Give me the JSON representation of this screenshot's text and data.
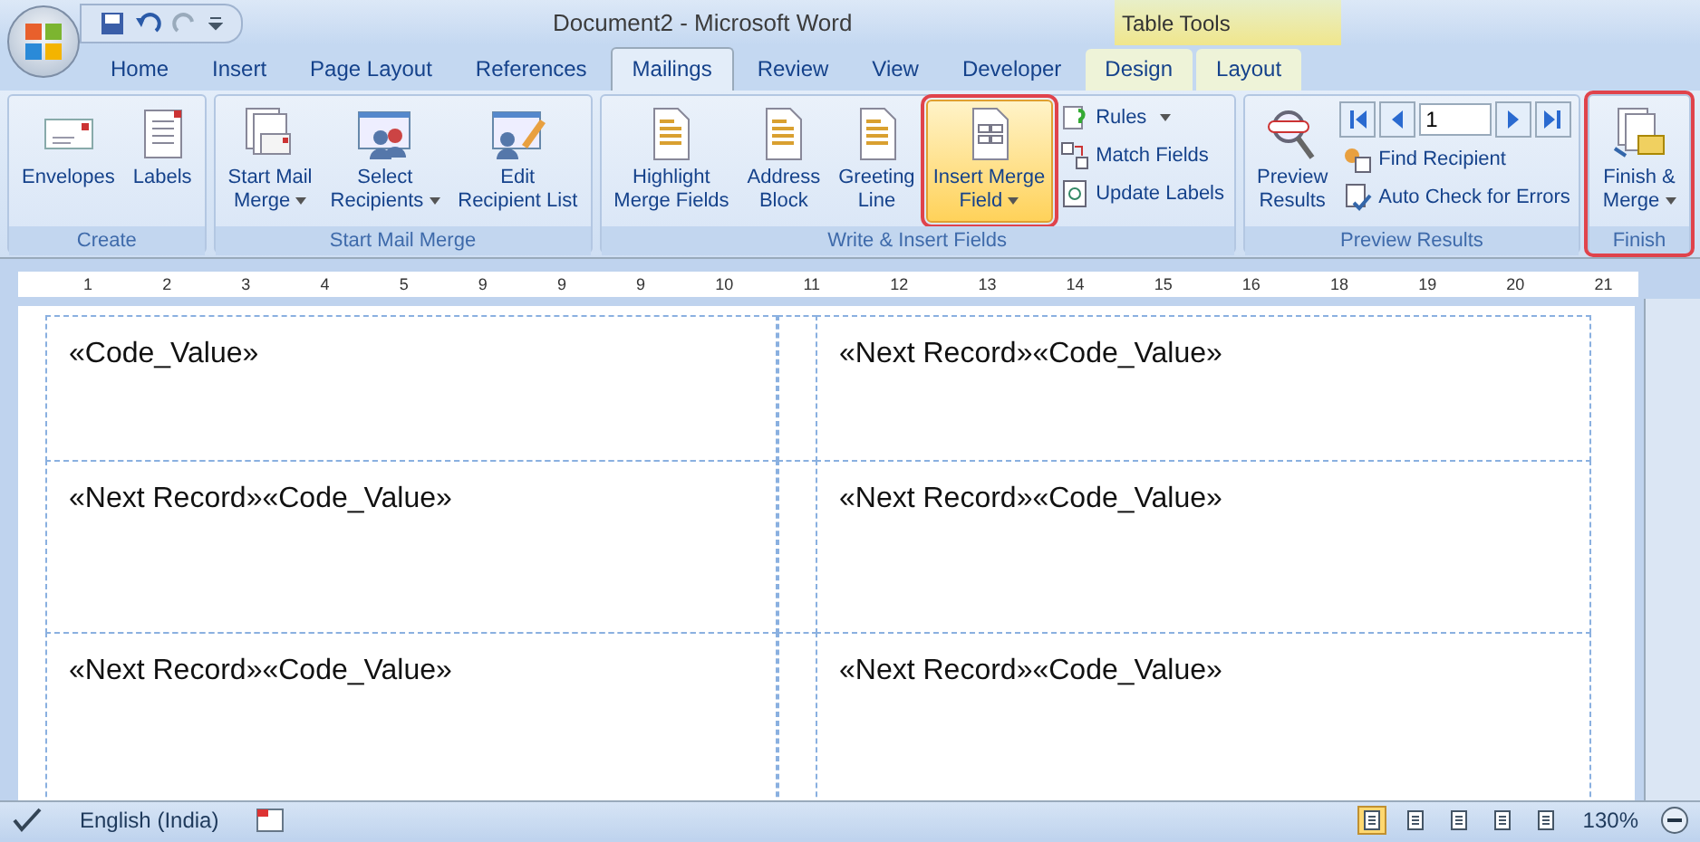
{
  "window": {
    "title": "Document2 - Microsoft Word",
    "context_group": "Table Tools"
  },
  "tabs": [
    {
      "label": "Home",
      "selected": false,
      "kind": "normal"
    },
    {
      "label": "Insert",
      "selected": false,
      "kind": "normal"
    },
    {
      "label": "Page Layout",
      "selected": false,
      "kind": "normal"
    },
    {
      "label": "References",
      "selected": false,
      "kind": "normal"
    },
    {
      "label": "Mailings",
      "selected": true,
      "kind": "normal"
    },
    {
      "label": "Review",
      "selected": false,
      "kind": "normal"
    },
    {
      "label": "View",
      "selected": false,
      "kind": "normal"
    },
    {
      "label": "Developer",
      "selected": false,
      "kind": "normal"
    },
    {
      "label": "Design",
      "selected": false,
      "kind": "contextual"
    },
    {
      "label": "Layout",
      "selected": false,
      "kind": "contextual"
    }
  ],
  "ribbon": {
    "groups": [
      {
        "label": "Create",
        "outlined": false,
        "items": [
          {
            "kind": "large",
            "label": "Envelopes",
            "dropdown": false,
            "highlighted": false
          },
          {
            "kind": "large",
            "label": "Labels",
            "dropdown": false,
            "highlighted": false
          }
        ]
      },
      {
        "label": "Start Mail Merge",
        "outlined": false,
        "items": [
          {
            "kind": "large",
            "label": "Start Mail\nMerge",
            "dropdown": true,
            "highlighted": false
          },
          {
            "kind": "large",
            "label": "Select\nRecipients",
            "dropdown": true,
            "highlighted": false
          },
          {
            "kind": "large",
            "label": "Edit\nRecipient List",
            "dropdown": false,
            "highlighted": false
          }
        ]
      },
      {
        "label": "Write & Insert Fields",
        "outlined": false,
        "items": [
          {
            "kind": "large",
            "label": "Highlight\nMerge Fields",
            "dropdown": false,
            "highlighted": false
          },
          {
            "kind": "large",
            "label": "Address\nBlock",
            "dropdown": false,
            "highlighted": false
          },
          {
            "kind": "large",
            "label": "Greeting\nLine",
            "dropdown": false,
            "highlighted": false
          },
          {
            "kind": "large",
            "label": "Insert Merge\nField",
            "dropdown": true,
            "highlighted": true
          },
          {
            "kind": "small",
            "label": "Rules",
            "dropdown": true
          },
          {
            "kind": "small",
            "label": "Match Fields",
            "dropdown": false
          },
          {
            "kind": "small",
            "label": "Update Labels",
            "dropdown": false
          }
        ]
      },
      {
        "label": "Preview Results",
        "outlined": false,
        "items": [
          {
            "kind": "large",
            "label": "Preview\nResults",
            "dropdown": false,
            "highlighted": false
          },
          {
            "kind": "record-nav",
            "value": "1"
          },
          {
            "kind": "small",
            "label": "Find Recipient",
            "dropdown": false
          },
          {
            "kind": "small",
            "label": "Auto Check for Errors",
            "dropdown": false
          }
        ]
      },
      {
        "label": "Finish",
        "outlined": true,
        "items": [
          {
            "kind": "large",
            "label": "Finish &\nMerge",
            "dropdown": true,
            "highlighted": false
          }
        ]
      }
    ]
  },
  "ruler": {
    "numbers": [
      "1",
      "2",
      "3",
      "4",
      "5",
      "9",
      "9",
      "9",
      "10",
      "11",
      "12",
      "13",
      "14",
      "15",
      "16",
      "18",
      "19",
      "20",
      "21"
    ]
  },
  "document": {
    "rows": [
      [
        "«Code_Value»",
        "«Next Record»«Code_Value»"
      ],
      [
        "«Next Record»«Code_Value»",
        "«Next Record»«Code_Value»"
      ],
      [
        "«Next Record»«Code_Value»",
        "«Next Record»«Code_Value»"
      ]
    ]
  },
  "status_bar": {
    "language": "English (India)",
    "zoom": "130%",
    "views": [
      {
        "selected": true
      },
      {
        "selected": false
      },
      {
        "selected": false
      },
      {
        "selected": false
      },
      {
        "selected": false
      }
    ]
  }
}
